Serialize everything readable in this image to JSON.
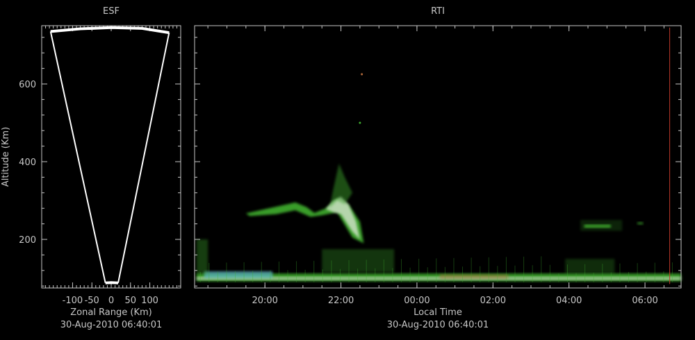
{
  "colors": {
    "background": "#000000",
    "axis": "#c8c8c8",
    "text": "#c8c8c8",
    "fan": "#ffffff",
    "cursor_line": "#c0392b",
    "echo_green": "#3fae2f",
    "echo_bright": "#dfe8d8",
    "echo_cyan": "#5fb8c8",
    "echo_orange": "#b36a3a"
  },
  "chart_data": [
    {
      "id": "esf",
      "type": "scatter",
      "title": "ESF",
      "xlabel": "Zonal Range (Km)",
      "ylabel": "Altitude (Km)",
      "footer": "30-Aug-2010 06:40:01",
      "xlim": [
        -180,
        180
      ],
      "ylim": [
        75,
        750
      ],
      "x_ticks": [
        -100,
        -50,
        0,
        50,
        100
      ],
      "x_tick_labels": [
        "-100",
        "-50",
        "0",
        "50",
        "100"
      ],
      "y_ticks": [
        200,
        400,
        600
      ],
      "y_tick_labels": [
        "200",
        "400",
        "600"
      ],
      "x_minor_step": 10,
      "y_minor_step": 40,
      "scan_sector": {
        "left_edge": [
          [
            -157,
            735
          ],
          [
            -15,
            88
          ]
        ],
        "right_edge": [
          [
            150,
            732
          ],
          [
            18,
            88
          ]
        ],
        "top_arc": [
          [
            -157,
            735
          ],
          [
            -80,
            742
          ],
          [
            0,
            745
          ],
          [
            80,
            743
          ],
          [
            150,
            732
          ]
        ],
        "bottom_arc": [
          [
            -15,
            88
          ],
          [
            0,
            89
          ],
          [
            18,
            88
          ]
        ]
      },
      "grid": false
    },
    {
      "id": "rti",
      "type": "heatmap",
      "title": "RTI",
      "xlabel": "Local Time",
      "ylabel": "",
      "footer": "30-Aug-2010 06:40:01",
      "xlim": [
        18.15,
        30.95
      ],
      "ylim": [
        75,
        750
      ],
      "x_ticks": [
        20,
        22,
        24,
        26,
        28,
        30
      ],
      "x_tick_labels": [
        "20:00",
        "22:00",
        "00:00",
        "02:00",
        "04:00",
        "06:00"
      ],
      "y_ticks": [
        200,
        400,
        600
      ],
      "x_minor_step": 0.5,
      "y_minor_step": 40,
      "cursor_time": 30.65,
      "cursor_alt_range": [
        85,
        745
      ],
      "grid": false,
      "echoes": [
        {
          "kind": "band",
          "t0": 18.2,
          "t1": 30.95,
          "a0": 92,
          "a1": 112,
          "color": "echo_green",
          "opacity": 0.85
        },
        {
          "kind": "band",
          "t0": 18.2,
          "t1": 30.95,
          "a0": 95,
          "a1": 104,
          "color": "echo_bright",
          "opacity": 0.55
        },
        {
          "kind": "band",
          "t0": 18.4,
          "t1": 20.2,
          "a0": 100,
          "a1": 118,
          "color": "echo_cyan",
          "opacity": 0.7
        },
        {
          "kind": "band",
          "t0": 24.6,
          "t1": 26.4,
          "a0": 98,
          "a1": 110,
          "color": "echo_orange",
          "opacity": 0.45
        },
        {
          "kind": "band",
          "t0": 18.2,
          "t1": 18.5,
          "a0": 110,
          "a1": 200,
          "color": "echo_green",
          "opacity": 0.35
        },
        {
          "kind": "band",
          "t0": 21.5,
          "t1": 23.4,
          "a0": 115,
          "a1": 175,
          "color": "echo_green",
          "opacity": 0.3
        },
        {
          "kind": "band",
          "t0": 27.9,
          "t1": 29.2,
          "a0": 112,
          "a1": 150,
          "color": "echo_green",
          "opacity": 0.25
        },
        {
          "kind": "plume",
          "color": "echo_green",
          "opacity": 0.9,
          "path": [
            [
              19.5,
              267
            ],
            [
              20.1,
              280
            ],
            [
              20.8,
              295
            ],
            [
              21.1,
              283
            ],
            [
              21.3,
              268
            ],
            [
              21.6,
              280
            ],
            [
              21.9,
              305
            ],
            [
              22.2,
              290
            ],
            [
              22.5,
              245
            ],
            [
              22.6,
              190
            ],
            [
              22.3,
              205
            ],
            [
              21.9,
              270
            ],
            [
              21.5,
              262
            ],
            [
              21.2,
              258
            ],
            [
              20.8,
              275
            ],
            [
              20.3,
              265
            ],
            [
              19.6,
              260
            ]
          ]
        },
        {
          "kind": "plume",
          "color": "echo_bright",
          "opacity": 0.75,
          "path": [
            [
              21.6,
              278
            ],
            [
              21.8,
              300
            ],
            [
              22.0,
              310
            ],
            [
              22.2,
              290
            ],
            [
              22.4,
              245
            ],
            [
              22.5,
              200
            ],
            [
              22.3,
              220
            ],
            [
              22.0,
              265
            ],
            [
              21.8,
              270
            ]
          ]
        },
        {
          "kind": "plume",
          "color": "echo_green",
          "opacity": 0.45,
          "path": [
            [
              21.7,
              280
            ],
            [
              21.8,
              330
            ],
            [
              21.95,
              395
            ],
            [
              22.1,
              360
            ],
            [
              22.3,
              320
            ],
            [
              22.1,
              290
            ],
            [
              21.9,
              300
            ]
          ]
        },
        {
          "kind": "band",
          "t0": 28.4,
          "t1": 29.1,
          "a0": 230,
          "a1": 238,
          "color": "echo_green",
          "opacity": 0.9
        },
        {
          "kind": "band",
          "t0": 28.3,
          "t1": 29.4,
          "a0": 222,
          "a1": 250,
          "color": "echo_green",
          "opacity": 0.2
        },
        {
          "kind": "band",
          "t0": 29.8,
          "t1": 29.95,
          "a0": 238,
          "a1": 245,
          "color": "echo_green",
          "opacity": 0.6
        },
        {
          "kind": "dot",
          "t": 22.55,
          "a": 625,
          "color": "echo_orange"
        },
        {
          "kind": "dot",
          "t": 22.5,
          "a": 500,
          "color": "echo_green"
        }
      ]
    }
  ]
}
